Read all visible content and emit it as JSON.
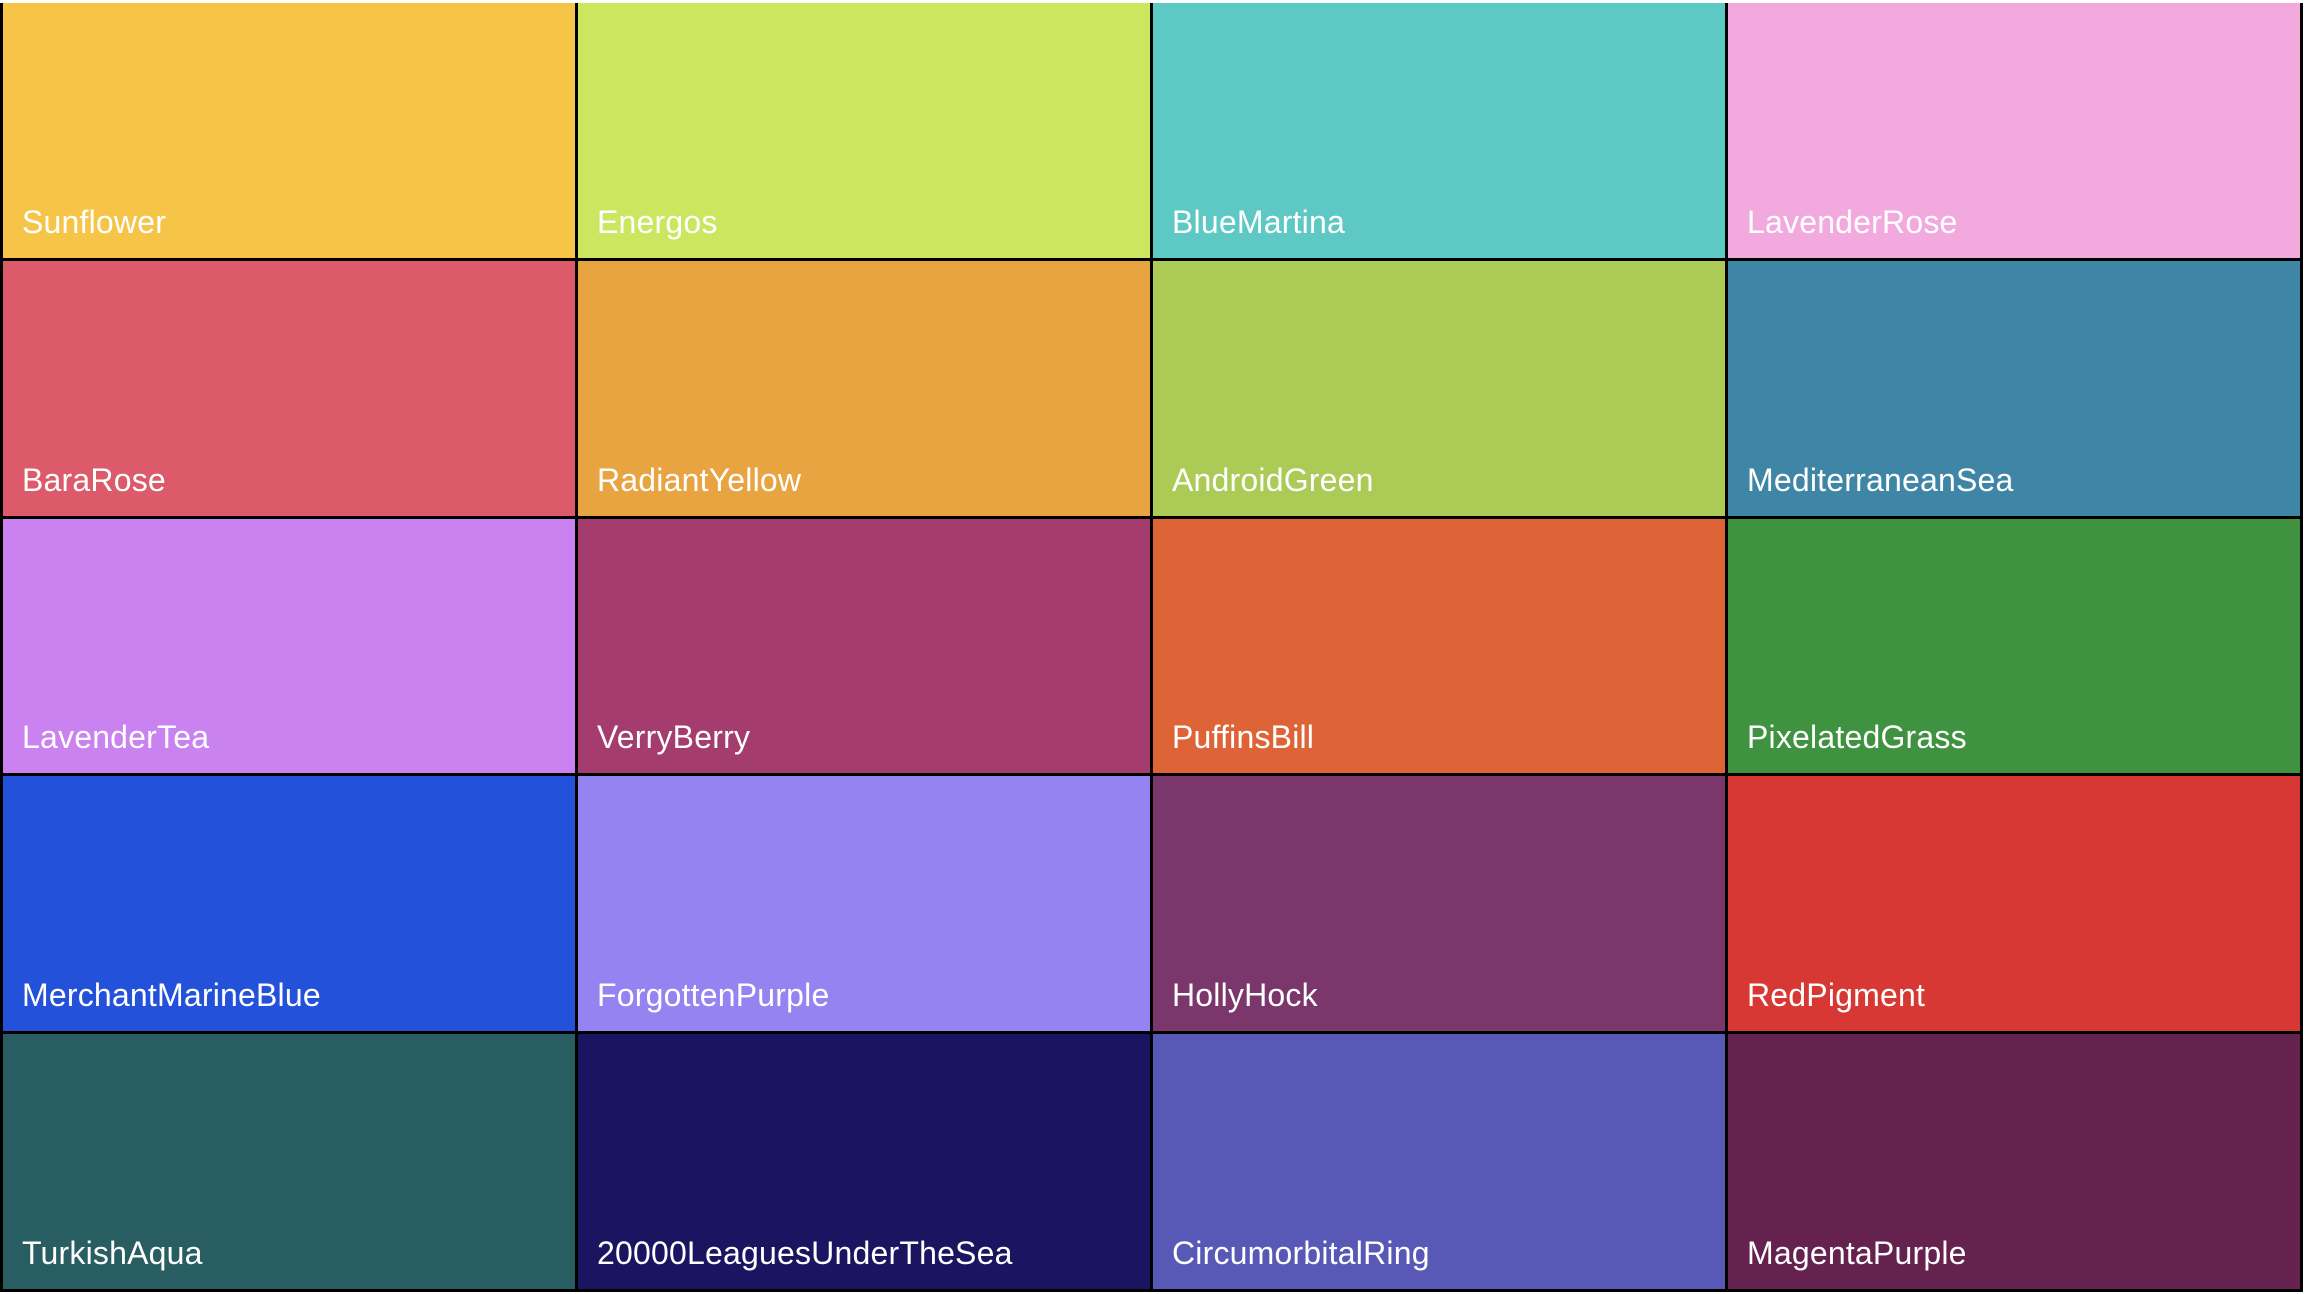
{
  "swatches": [
    {
      "name": "Sunflower",
      "color": "#F6C547"
    },
    {
      "name": "Energos",
      "color": "#CCE65F"
    },
    {
      "name": "BlueMartina",
      "color": "#5EC9C4"
    },
    {
      "name": "LavenderRose",
      "color": "#F2A9DE"
    },
    {
      "name": "BaraRose",
      "color": "#DC5A69"
    },
    {
      "name": "RadiantYellow",
      "color": "#E9A442"
    },
    {
      "name": "AndroidGreen",
      "color": "#ACCA56"
    },
    {
      "name": "MediterraneanSea",
      "color": "#3F86A6"
    },
    {
      "name": "LavenderTea",
      "color": "#C982F0"
    },
    {
      "name": "VerryBerry",
      "color": "#A43C6D"
    },
    {
      "name": "PuffinsBill",
      "color": "#DE6437"
    },
    {
      "name": "PixelatedGrass",
      "color": "#3F9340"
    },
    {
      "name": "MerchantMarineBlue",
      "color": "#2351D9"
    },
    {
      "name": "ForgottenPurple",
      "color": "#9483F1"
    },
    {
      "name": "HollyHock",
      "color": "#7B376C"
    },
    {
      "name": "RedPigment",
      "color": "#D83833"
    },
    {
      "name": "TurkishAqua",
      "color": "#285E62"
    },
    {
      "name": "20000LeaguesUnderTheSea",
      "color": "#1A1461"
    },
    {
      "name": "CircumorbitalRing",
      "color": "#5858B6"
    },
    {
      "name": "MagentaPurple",
      "color": "#65224E"
    }
  ]
}
